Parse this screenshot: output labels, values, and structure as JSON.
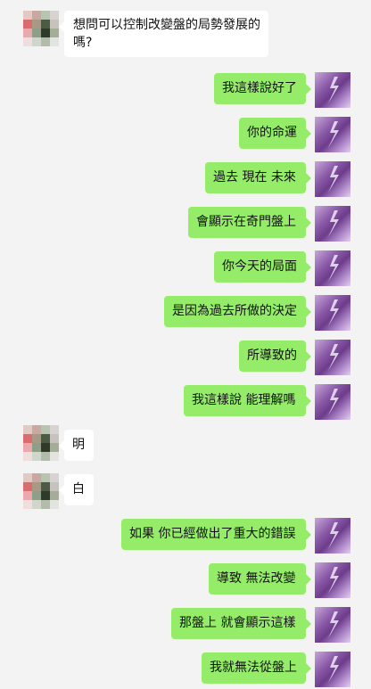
{
  "contact": {
    "avatar_icon": "pixelated-contact-avatar-icon"
  },
  "self": {
    "avatar_icon": "purple-lightning-avatar-icon"
  },
  "messages": [
    {
      "side": "left",
      "text_lines": [
        "想問可以控制改變盤的局勢發展的",
        "嗎?"
      ]
    },
    {
      "side": "right",
      "text": "我這樣說好了"
    },
    {
      "side": "right",
      "text": "你的命運"
    },
    {
      "side": "right",
      "text": "過去 現在 未來"
    },
    {
      "side": "right",
      "text": "會顯示在奇門盤上"
    },
    {
      "side": "right",
      "text": "你今天的局面"
    },
    {
      "side": "right",
      "text": "是因為過去所做的決定"
    },
    {
      "side": "right",
      "text": "所導致的"
    },
    {
      "side": "right",
      "text": "我這樣說 能理解嗎"
    },
    {
      "side": "left",
      "text": "明"
    },
    {
      "side": "left",
      "text": "白"
    },
    {
      "side": "right",
      "text": "如果 你已經做出了重大的錯誤"
    },
    {
      "side": "right",
      "text": "導致 無法改變"
    },
    {
      "side": "right",
      "text": "那盤上 就會顯示這樣"
    },
    {
      "side": "right",
      "text": "我就無法從盤上"
    }
  ],
  "colors": {
    "background": "#f3f3f3",
    "right_bubble": "#95ec69",
    "left_bubble": "#ffffff"
  }
}
